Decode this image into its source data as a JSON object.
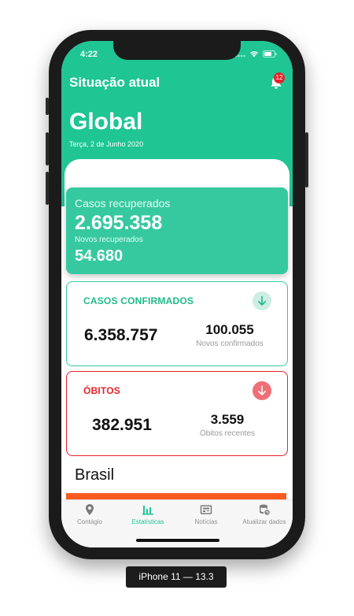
{
  "status_bar": {
    "time": "4:22"
  },
  "header": {
    "title": "Situação atual",
    "notification_count": "12",
    "region": "Global",
    "date": "Terça, 2 de Junho 2020"
  },
  "recovered": {
    "label": "Casos recuperados",
    "total": "2.695.358",
    "new_label": "Novos recuperados",
    "new_value": "54.680"
  },
  "confirmed": {
    "title": "CASOS CONFIRMADOS",
    "total": "6.358.757",
    "new_value": "100.055",
    "new_label": "Novos confirmados"
  },
  "deaths": {
    "title": "ÓBITOS",
    "total": "382.951",
    "new_value": "3.559",
    "new_label": "Óbitos recentes"
  },
  "country": {
    "name": "Brasil"
  },
  "tabs": [
    {
      "label": "Contágio",
      "icon": "location-pin-icon",
      "active": false
    },
    {
      "label": "Estatísticas",
      "icon": "bar-chart-icon",
      "active": true
    },
    {
      "label": "Notícias",
      "icon": "newspaper-icon",
      "active": false
    },
    {
      "label": "Atualizar dados",
      "icon": "database-refresh-icon",
      "active": false
    }
  ],
  "device": {
    "label": "iPhone 11 — 13.3"
  },
  "colors": {
    "primary": "#1fc593",
    "recovered_card": "#36c9a0",
    "deaths_red": "#e8202a",
    "orange": "#fb5a1f"
  }
}
